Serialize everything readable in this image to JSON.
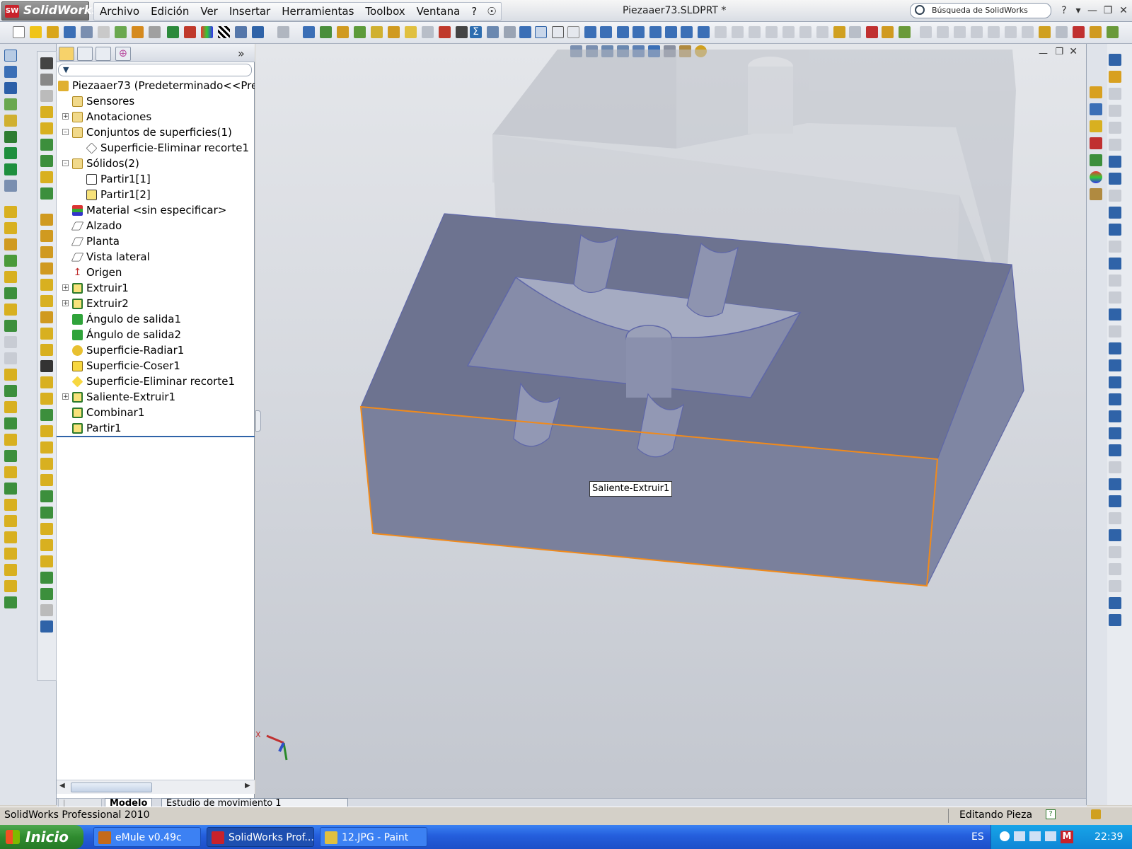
{
  "app": {
    "brand": "SolidWorks",
    "document_title": "Piezaaer73.SLDPRT *",
    "search_placeholder": "Búsqueda de SolidWorks",
    "help_label": "?"
  },
  "menu": [
    "Archivo",
    "Edición",
    "Ver",
    "Insertar",
    "Herramientas",
    "Toolbox",
    "Ventana",
    "?"
  ],
  "feature_tree": {
    "root": "Piezaaer73  (Predeterminado<<Prec",
    "items": [
      {
        "label": "Sensores",
        "icon": "sensor-icon"
      },
      {
        "label": "Anotaciones",
        "icon": "annotations-icon"
      },
      {
        "label": "Conjuntos de superficies(1)",
        "icon": "surface-bodies-folder-icon"
      },
      {
        "label": "Superficie-Eliminar recorte1",
        "icon": "surface-icon"
      },
      {
        "label": "Sólidos(2)",
        "icon": "solid-bodies-folder-icon"
      },
      {
        "label": "Partir1[1]",
        "icon": "body-icon"
      },
      {
        "label": "Partir1[2]",
        "icon": "body-icon"
      },
      {
        "label": "Material <sin especificar>",
        "icon": "material-icon"
      },
      {
        "label": "Alzado",
        "icon": "plane-icon"
      },
      {
        "label": "Planta",
        "icon": "plane-icon"
      },
      {
        "label": "Vista lateral",
        "icon": "plane-icon"
      },
      {
        "label": "Origen",
        "icon": "origin-icon"
      },
      {
        "label": "Extruir1",
        "icon": "extrude-icon"
      },
      {
        "label": "Extruir2",
        "icon": "extrude-icon"
      },
      {
        "label": "Ángulo de salida1",
        "icon": "draft-icon"
      },
      {
        "label": "Ángulo de salida2",
        "icon": "draft-icon"
      },
      {
        "label": "Superficie-Radiar1",
        "icon": "radiate-surface-icon"
      },
      {
        "label": "Superficie-Coser1",
        "icon": "knit-surface-icon"
      },
      {
        "label": "Superficie-Eliminar recorte1",
        "icon": "untrim-surface-icon"
      },
      {
        "label": "Saliente-Extruir1",
        "icon": "boss-extrude-icon"
      },
      {
        "label": "Combinar1",
        "icon": "combine-icon"
      },
      {
        "label": "Partir1",
        "icon": "split-icon"
      }
    ]
  },
  "bottom_tabs": [
    "Modelo",
    "Estudio de movimiento 1"
  ],
  "viewport": {
    "tooltip": "Saliente-Extruir1",
    "triad_label": "X"
  },
  "status": {
    "product": "SolidWorks Professional 2010",
    "mode": "Editando Pieza"
  },
  "taskbar": {
    "start": "Inicio",
    "tasks": [
      {
        "label": "eMule v0.49c"
      },
      {
        "label": "SolidWorks Prof..."
      },
      {
        "label": "12.JPG - Paint"
      }
    ],
    "lang": "ES",
    "clock": "22:39"
  },
  "colors": {
    "body_face": "#6d7390",
    "selection_edge": "#f08a1c",
    "taskbar": "#245edc"
  }
}
